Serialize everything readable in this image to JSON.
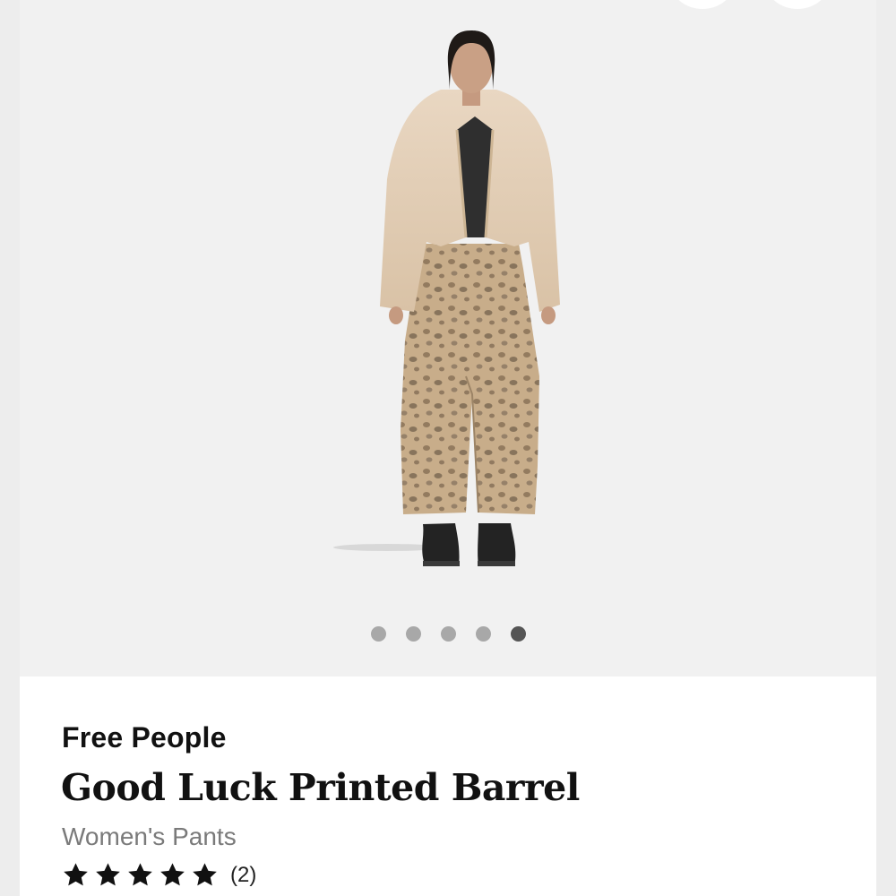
{
  "gallery": {
    "image_alt": "Model wearing faux fur jacket and leopard print barrel pants",
    "dots_total": 5,
    "active_dot_index": 4
  },
  "product": {
    "brand": "Free People",
    "title": "Good Luck Printed Barrel",
    "category": "Women's Pants",
    "rating_value": 5,
    "rating_count": "(2)"
  },
  "colors": {
    "background": "#f1f1f1",
    "dot_inactive": "#a8a8a8",
    "dot_active": "#555555",
    "text_primary": "#111111",
    "text_secondary": "#7a7a7a",
    "star": "#111111"
  },
  "icons": {
    "star": "star-icon"
  }
}
